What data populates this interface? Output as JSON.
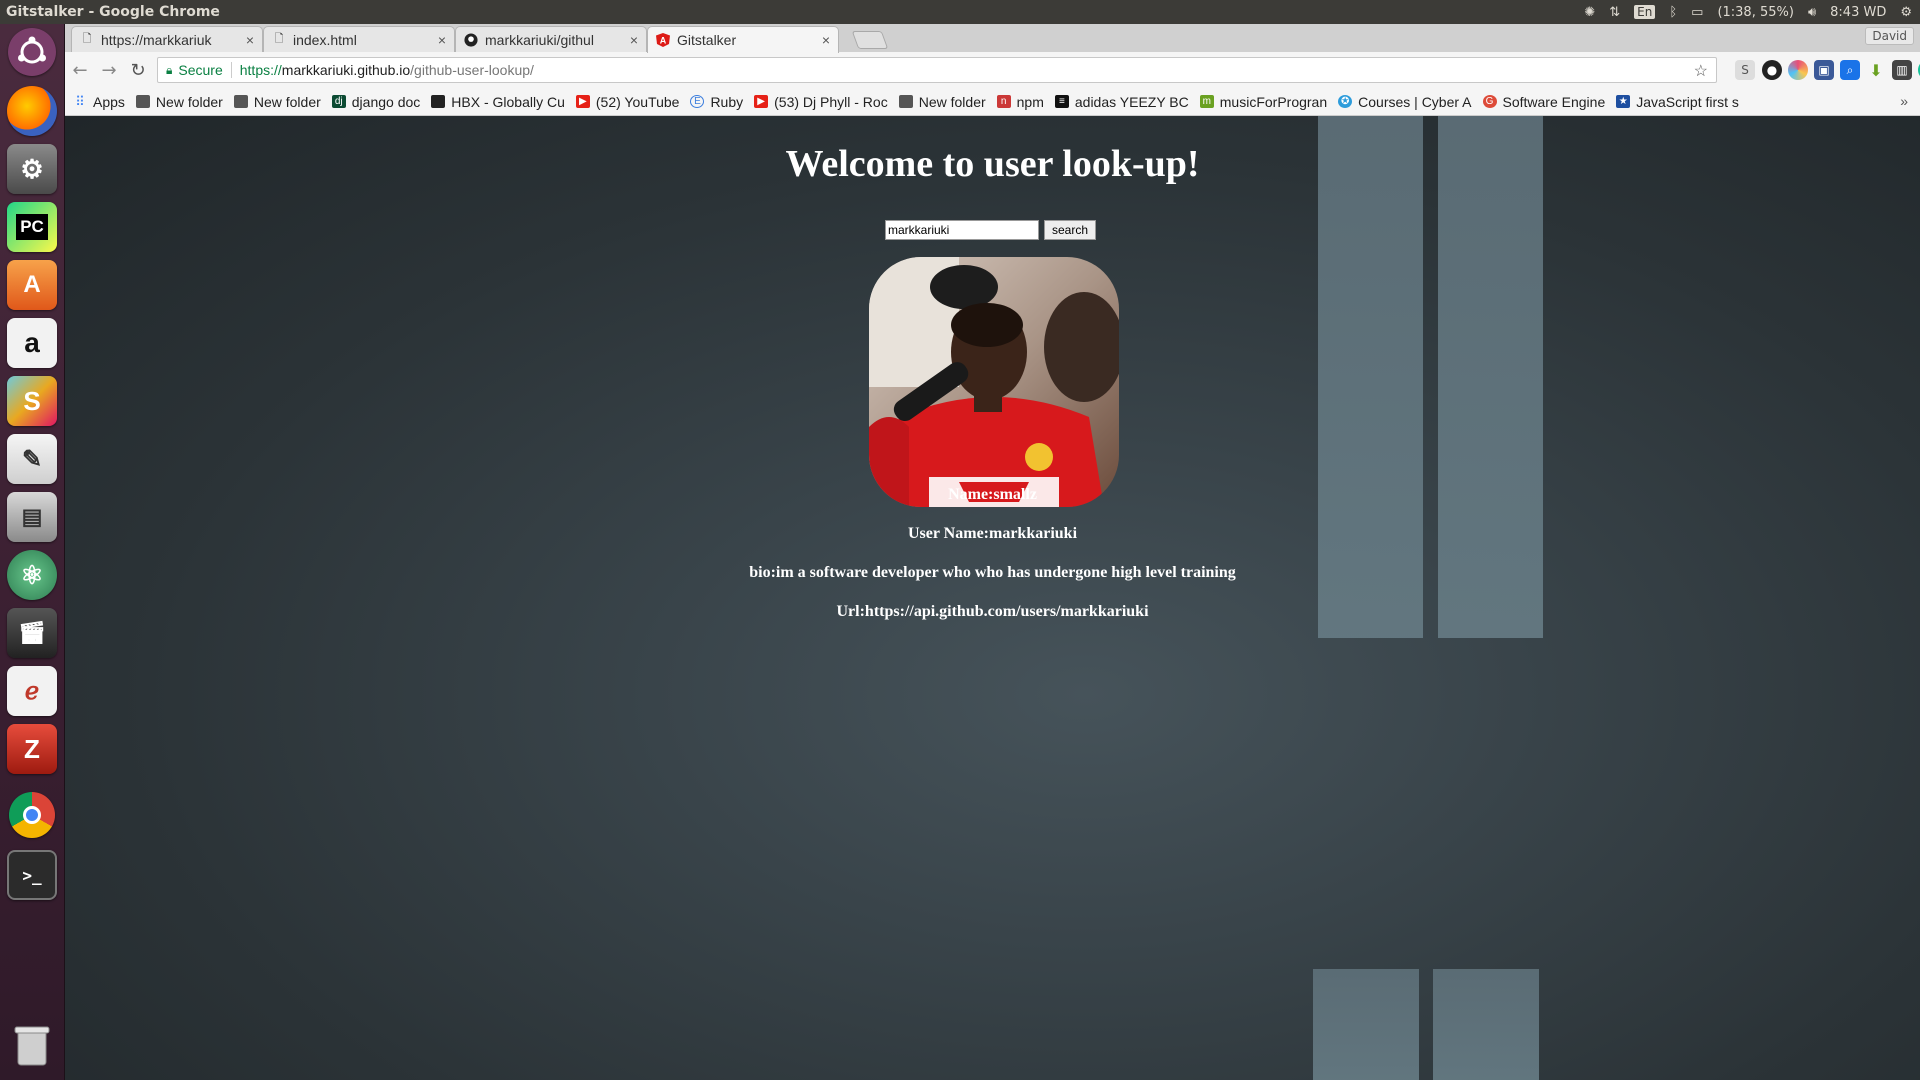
{
  "os": {
    "window_title": "Gitstalker - Google Chrome",
    "keyboard": "En",
    "battery": "(1:38, 55%)",
    "clock": "8:43 WD"
  },
  "browser": {
    "profile": "David",
    "tabs": [
      {
        "label": "https://markkariuk",
        "icon": "page-icon",
        "active": false
      },
      {
        "label": "index.html",
        "icon": "page-icon",
        "active": false
      },
      {
        "label": "markkariuki/githul",
        "icon": "github-icon",
        "active": false
      },
      {
        "label": "Gitstalker",
        "icon": "angular-icon",
        "active": true
      }
    ],
    "omnibox": {
      "secure_label": "Secure",
      "url_scheme": "https://",
      "url_host": "markkariuki.github.io",
      "url_path": "/github-user-lookup/"
    },
    "bookmarks": [
      {
        "label": "Apps",
        "icon": "apps-grid-icon",
        "color": "#4285f4"
      },
      {
        "label": "New folder",
        "icon": "folder-icon",
        "color": "#555555"
      },
      {
        "label": "New folder",
        "icon": "folder-icon",
        "color": "#555555"
      },
      {
        "label": "django doc",
        "icon": "django-icon",
        "color": "#0c4b33"
      },
      {
        "label": "HBX - Globally Cu",
        "icon": "hbx-icon",
        "color": "#222222"
      },
      {
        "label": "(52) YouTube",
        "icon": "youtube-icon",
        "color": "#e62117"
      },
      {
        "label": "Ruby",
        "icon": "ruby-icon",
        "color": "#3b7ddd"
      },
      {
        "label": "(53) Dj Phyll - Roc",
        "icon": "youtube-icon",
        "color": "#e62117"
      },
      {
        "label": "New folder",
        "icon": "folder-icon",
        "color": "#555555"
      },
      {
        "label": "npm",
        "icon": "npm-icon",
        "color": "#cb3837"
      },
      {
        "label": "adidas YEEZY BC",
        "icon": "adidas-icon",
        "color": "#111111"
      },
      {
        "label": "musicForProgran",
        "icon": "music-icon",
        "color": "#6aa121"
      },
      {
        "label": "Courses | Cyber A",
        "icon": "courses-icon",
        "color": "#2d9cdb"
      },
      {
        "label": "Software Engine",
        "icon": "google-plus-icon",
        "color": "#dd4b39"
      },
      {
        "label": "JavaScript first s",
        "icon": "bookmark-icon",
        "color": "#1e4fa0"
      }
    ]
  },
  "page": {
    "heading": "Welcome to user look-up!",
    "search": {
      "value": "markkariuki",
      "button": "search"
    },
    "name_line": "Name:smallz",
    "username_line": "User Name:markkariuki",
    "bio_line": "bio:im a software developer who who has undergone high level training",
    "url_line": "Url:https://api.github.com/users/markkariuki"
  }
}
